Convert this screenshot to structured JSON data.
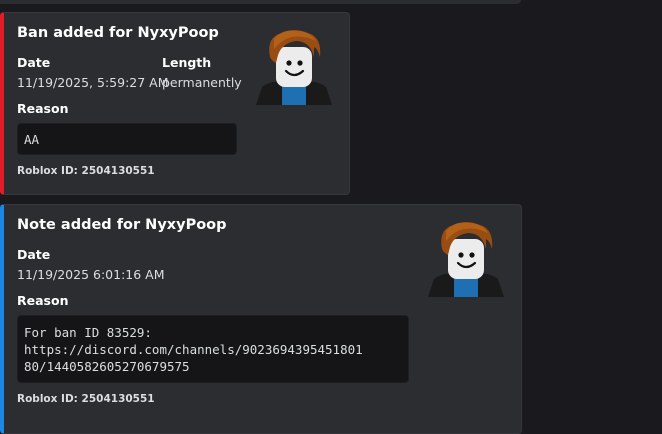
{
  "colors": {
    "ban_accent": "#e11d2a",
    "note_accent": "#1e86e5",
    "embed_bg": "#2b2d31",
    "page_bg": "#1a1a1e"
  },
  "ban_embed": {
    "title": "Ban added for NyxyPoop",
    "date_label": "Date",
    "date_value": "11/19/2025, 5:59:27 AM",
    "length_label": "Length",
    "length_value": "permanently",
    "reason_label": "Reason",
    "reason_value": "AA",
    "footer": "Roblox ID: 2504130551",
    "thumbnail_icon": "roblox-avatar-icon"
  },
  "note_embed": {
    "title": "Note added for NyxyPoop",
    "date_label": "Date",
    "date_value": "11/19/2025 6:01:16 AM",
    "reason_label": "Reason",
    "reason_value": "For ban ID 83529:\nhttps://discord.com/channels/9023694395451801\n80/1440582605270679575",
    "footer": "Roblox ID: 2504130551",
    "thumbnail_icon": "roblox-avatar-icon"
  }
}
